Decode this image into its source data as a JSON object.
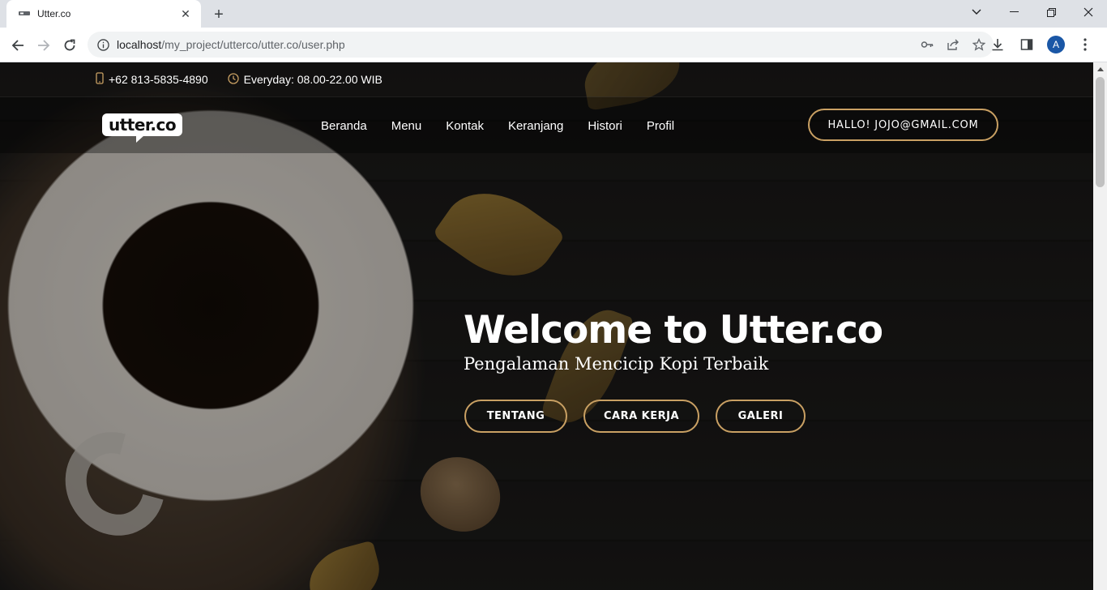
{
  "browser": {
    "tab_title": "Utter.co",
    "url_host": "localhost",
    "url_path": "/my_project/utterco/utter.co/user.php",
    "profile_initial": "A"
  },
  "site": {
    "phone": "+62 813-5835-4890",
    "hours": "Everyday: 08.00-22.00 WIB",
    "logo": "utter.co",
    "nav": [
      "Beranda",
      "Menu",
      "Kontak",
      "Keranjang",
      "Histori",
      "Profil"
    ],
    "hello_button": "HALLO! JOJO@GMAIL.COM",
    "hero_title": "Welcome to Utter.co",
    "hero_subtitle": "Pengalaman Mencicip Kopi Terbaik",
    "cta": [
      "TENTANG",
      "CARA KERJA",
      "GALERI"
    ]
  },
  "colors": {
    "accent": "#c9a063",
    "tab_bar": "#dee1e6",
    "avatar": "#1a57a6"
  }
}
